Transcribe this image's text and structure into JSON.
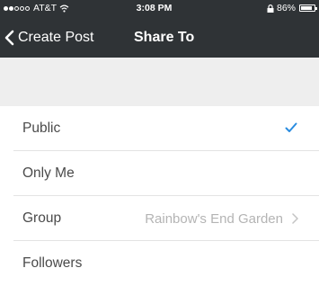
{
  "status_bar": {
    "carrier": "AT&T",
    "signal_bars_filled": 2,
    "signal_bars_total": 5,
    "time": "3:08 PM",
    "battery": "86%",
    "battery_level": 0.86,
    "icons": [
      "wifi-icon",
      "lock-rotation-icon",
      "battery-icon"
    ]
  },
  "nav": {
    "back_label": "Create Post",
    "back_icon": "chevron-left-icon",
    "title": "Share To"
  },
  "options": [
    {
      "label": "Public",
      "selected": true,
      "detail": ""
    },
    {
      "label": "Only Me",
      "selected": false,
      "detail": ""
    },
    {
      "label": "Group",
      "selected": false,
      "detail": "Rainbow's End Garden"
    },
    {
      "label": "Followers",
      "selected": false,
      "detail": ""
    }
  ],
  "colors": {
    "header_bg": "#2f3336",
    "accent": "#2a8ce0",
    "section_bg": "#eeeeee"
  }
}
